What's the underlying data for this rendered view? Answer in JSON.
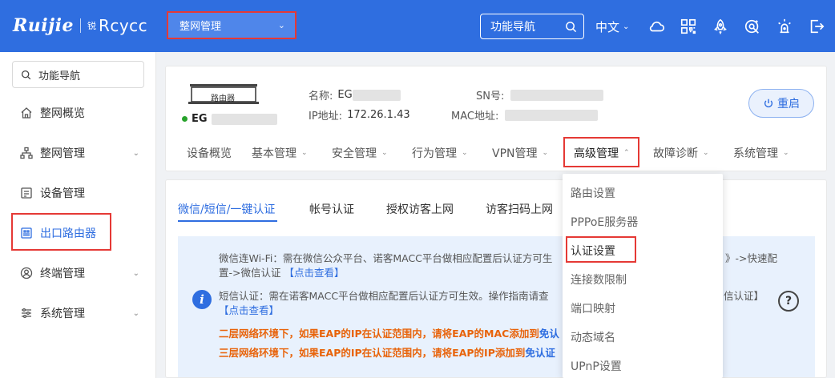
{
  "header": {
    "brand": "Ruijie",
    "sub_brand_prefix": "锐",
    "sub_brand": "Rcycc",
    "scope_select": "整网管理",
    "nav_search": "功能导航",
    "language": "中文",
    "icons": [
      "cloud-icon",
      "qrcode-icon",
      "rocket-icon",
      "monitor-icon",
      "alarm-icon",
      "logout-icon"
    ]
  },
  "sidebar": {
    "search_placeholder": "功能导航",
    "items": [
      {
        "label": "整网概览",
        "icon": "home-icon",
        "has_children": false
      },
      {
        "label": "整网管理",
        "icon": "topology-icon",
        "has_children": true
      },
      {
        "label": "设备管理",
        "icon": "device-icon",
        "has_children": false
      },
      {
        "label": "出口路由器",
        "icon": "router-icon",
        "has_children": false,
        "active": true
      },
      {
        "label": "终端管理",
        "icon": "user-icon",
        "has_children": true
      },
      {
        "label": "系统管理",
        "icon": "settings-icon",
        "has_children": true
      }
    ]
  },
  "device": {
    "image_label": "路由器",
    "name_prefix": "EG",
    "name_label": "名称:",
    "name_value": "EG",
    "ip_label": "IP地址:",
    "ip_value": "172.26.1.43",
    "sn_label": "SN号:",
    "mac_label": "MAC地址:",
    "reboot": "重启",
    "status_color": "#27a22b"
  },
  "tabs": [
    {
      "label": "设备概览",
      "dropdown": false
    },
    {
      "label": "基本管理",
      "dropdown": true
    },
    {
      "label": "安全管理",
      "dropdown": true
    },
    {
      "label": "行为管理",
      "dropdown": true
    },
    {
      "label": "VPN管理",
      "dropdown": true
    },
    {
      "label": "高级管理",
      "dropdown": true,
      "open": true
    },
    {
      "label": "故障诊断",
      "dropdown": true
    },
    {
      "label": "系统管理",
      "dropdown": true
    }
  ],
  "subtabs": [
    {
      "label": "微信/短信/一键认证",
      "active": true
    },
    {
      "label": "帐号认证"
    },
    {
      "label": "授权访客上网"
    },
    {
      "label": "访客扫码上网"
    }
  ],
  "notice": {
    "line1": "微信连Wi-Fi：需在微信公众平台、诺客MACC平台做相应配置后认证方可生",
    "line1_tail": "》->快速配",
    "line2": "置->微信认证",
    "line2_link": "【点击查看】",
    "line3": "短信认证：需在诺客MACC平台做相应配置后认证方可生效。操作指南请查",
    "line3_tail": "信认证】",
    "line4_link": "【点击查看】",
    "warn1": "二层网络环境下，如果EAP的IP在认证范围内，请将EAP的MAC添加到",
    "warn1_link": "免认",
    "warn2": "三层网络环境下，如果EAP的IP在认证范围内，请将EAP的IP添加到",
    "warn2_link": "免认证"
  },
  "dropdown": {
    "items": [
      "路由设置",
      "PPPoE服务器",
      "认证设置",
      "连接数限制",
      "端口映射",
      "动态域名",
      "UPnP设置"
    ],
    "highlighted": "认证设置"
  },
  "colors": {
    "primary": "#2f6ee0",
    "highlight_border": "#e53935",
    "warning_text": "#e8630a"
  }
}
